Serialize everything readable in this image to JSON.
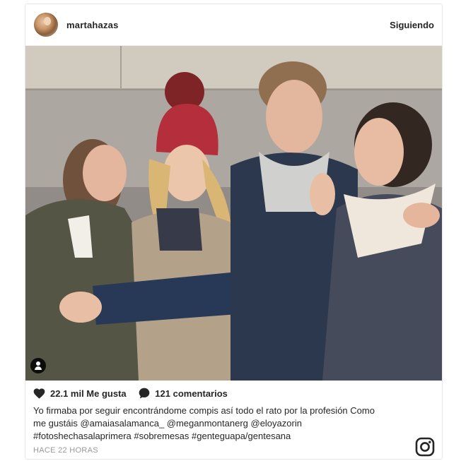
{
  "post": {
    "username": "martahazas",
    "follow_label": "Siguiendo",
    "likes_label": "22.1 mil Me gusta",
    "comments_label": "121 comentarios",
    "caption_lines": [
      "Yo firmaba por seguir encontrándome compis así todo el rato por la profesión Como",
      "me gustáis @amaiasalamanca_ @meganmontanerg @eloyazorin",
      "#fotoshechasalaprimera #sobremesas #genteguapa/gentesana"
    ],
    "timestamp": "HACE 22 HORAS"
  },
  "icons": {
    "avatar": "profile-avatar",
    "tag": "user-tag-icon",
    "like": "heart-icon",
    "comment": "comment-bubble-icon",
    "brand": "instagram-logo-icon"
  },
  "colors": {
    "text": "#262626",
    "muted": "#999999",
    "border": "#e6e6e6"
  }
}
